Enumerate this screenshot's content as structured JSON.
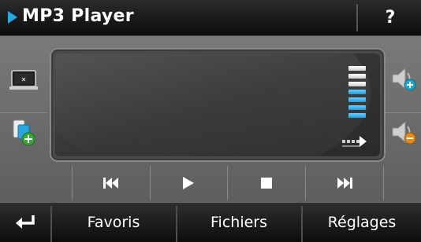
{
  "title": "MP3 Player",
  "help_label": "?",
  "bottom_bar": {
    "favorites_label": "Favoris",
    "files_label": "Fichiers",
    "settings_label": "Réglages"
  },
  "volume": {
    "level_bars_lit": 4,
    "total_bars": 7
  },
  "colors": {
    "accent": "#2aa7e0",
    "volume_active": "#1e9ad9"
  },
  "icons": {
    "back": "return-arrow-icon",
    "prev": "skip-previous-icon",
    "play": "play-icon",
    "stop": "stop-icon",
    "next": "skip-next-icon",
    "display": "monitor-icon",
    "add_media": "add-media-icon",
    "volume_up": "volume-up-icon",
    "volume_down": "volume-down-icon",
    "output": "output-arrow-icon"
  }
}
